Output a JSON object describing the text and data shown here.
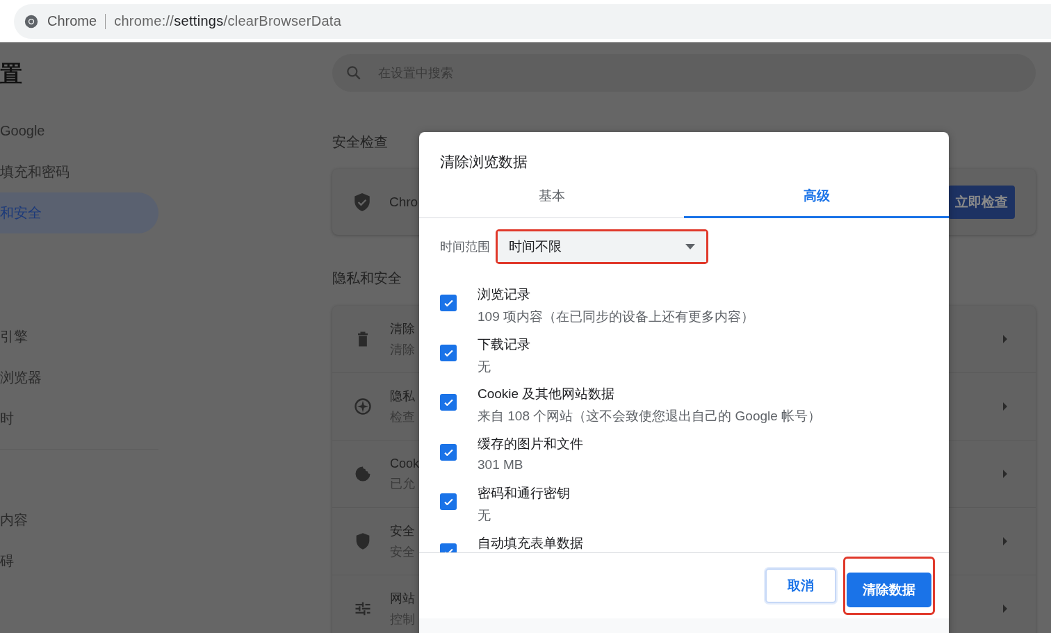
{
  "address_bar": {
    "site": "Chrome",
    "url_parts": [
      {
        "text": "chrome://",
        "strong": false
      },
      {
        "text": "settings",
        "strong": true
      },
      {
        "text": "/clearBrowserData",
        "strong": false
      }
    ]
  },
  "sidebar": {
    "title": "置",
    "groups": [
      {
        "items": [
          {
            "label": "Google",
            "selected": false
          },
          {
            "label": "填充和密码",
            "selected": false
          },
          {
            "label": "和安全",
            "selected": true
          }
        ]
      },
      {
        "items": [
          {
            "label": "引擎",
            "selected": false
          },
          {
            "label": "浏览器",
            "selected": false
          },
          {
            "label": "时",
            "selected": false
          }
        ]
      },
      {
        "items": [
          {
            "label": "内容",
            "selected": false
          },
          {
            "label": "碍",
            "selected": false
          }
        ]
      }
    ]
  },
  "search": {
    "placeholder": "在设置中搜索"
  },
  "safety_check": {
    "heading": "安全检查",
    "card_text": "Chro",
    "button": "立即检查"
  },
  "privacy": {
    "heading": "隐私和安全",
    "rows": [
      {
        "title": "清除",
        "subtitle": "清除"
      },
      {
        "title": "隐私",
        "subtitle": "检查"
      },
      {
        "title": "Cook",
        "subtitle": "已允"
      },
      {
        "title": "安全",
        "subtitle": "安全"
      },
      {
        "title": "网站",
        "subtitle": "控制"
      }
    ]
  },
  "dialog": {
    "title": "清除浏览数据",
    "tabs": [
      {
        "label": "基本",
        "selected": false
      },
      {
        "label": "高级",
        "selected": true
      }
    ],
    "time_range": {
      "label": "时间范围",
      "value": "时间不限",
      "highlighted": true
    },
    "items": [
      {
        "title": "浏览记录",
        "detail": "109 项内容（在已同步的设备上还有更多内容）",
        "checked": true
      },
      {
        "title": "下载记录",
        "detail": "无",
        "checked": true
      },
      {
        "title": "Cookie 及其他网站数据",
        "detail": "来自 108 个网站（这不会致使您退出自己的 Google 帐号）",
        "checked": true
      },
      {
        "title": "缓存的图片和文件",
        "detail": "301 MB",
        "checked": true
      },
      {
        "title": "密码和通行密钥",
        "detail": "无",
        "checked": true
      },
      {
        "title": "自动填充表单数据",
        "checked": true
      }
    ],
    "buttons": [
      {
        "label": "取消",
        "kind": "secondary",
        "highlighted": false
      },
      {
        "label": "清除数据",
        "kind": "primary",
        "highlighted": true
      }
    ]
  }
}
